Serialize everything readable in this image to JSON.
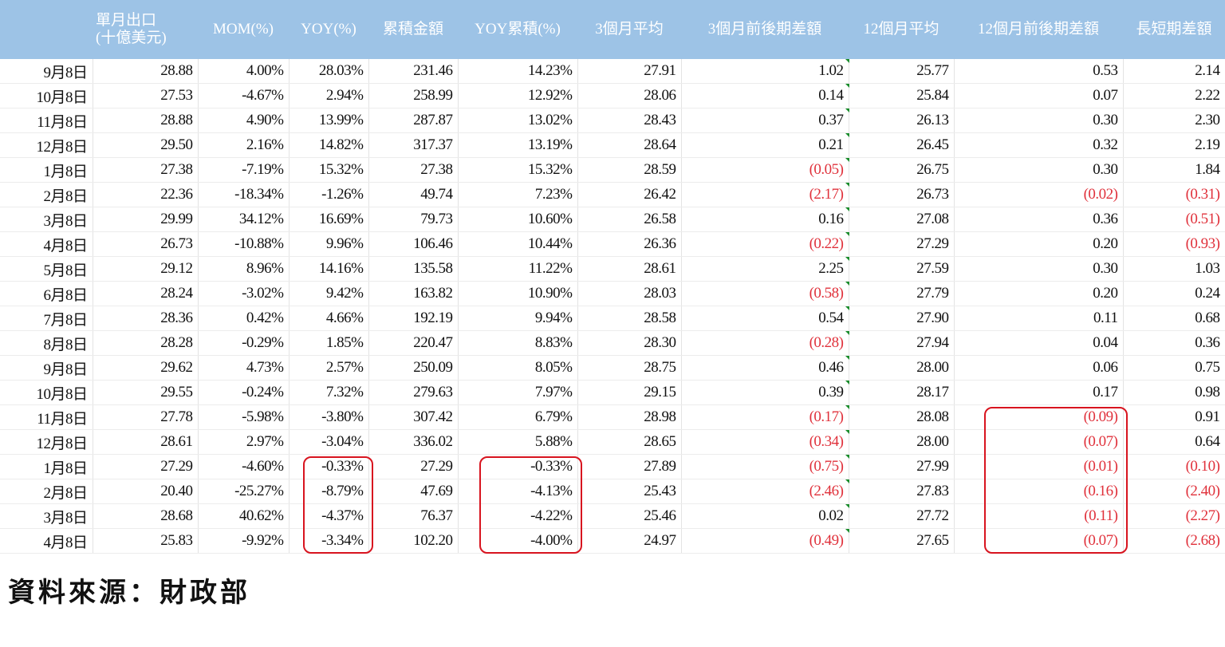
{
  "chart_data": {
    "type": "table",
    "columns": [
      "",
      "單月出口\n(十億美元)",
      "MOM(%)",
      "YOY(%)",
      "累積金額",
      "YOY累積(%)",
      "3個月平均",
      "3個月前後期差額",
      "12個月平均",
      "12個月前後期差額",
      "長短期差額"
    ],
    "rows": [
      [
        "9月8日",
        "28.88",
        "4.00%",
        "28.03%",
        "231.46",
        "14.23%",
        "27.91",
        "1.02",
        "25.77",
        "0.53",
        "2.14"
      ],
      [
        "10月8日",
        "27.53",
        "-4.67%",
        "2.94%",
        "258.99",
        "12.92%",
        "28.06",
        "0.14",
        "25.84",
        "0.07",
        "2.22"
      ],
      [
        "11月8日",
        "28.88",
        "4.90%",
        "13.99%",
        "287.87",
        "13.02%",
        "28.43",
        "0.37",
        "26.13",
        "0.30",
        "2.30"
      ],
      [
        "12月8日",
        "29.50",
        "2.16%",
        "14.82%",
        "317.37",
        "13.19%",
        "28.64",
        "0.21",
        "26.45",
        "0.32",
        "2.19"
      ],
      [
        "1月8日",
        "27.38",
        "-7.19%",
        "15.32%",
        "27.38",
        "15.32%",
        "28.59",
        "(0.05)",
        "26.75",
        "0.30",
        "1.84"
      ],
      [
        "2月8日",
        "22.36",
        "-18.34%",
        "-1.26%",
        "49.74",
        "7.23%",
        "26.42",
        "(2.17)",
        "26.73",
        "(0.02)",
        "(0.31)"
      ],
      [
        "3月8日",
        "29.99",
        "34.12%",
        "16.69%",
        "79.73",
        "10.60%",
        "26.58",
        "0.16",
        "27.08",
        "0.36",
        "(0.51)"
      ],
      [
        "4月8日",
        "26.73",
        "-10.88%",
        "9.96%",
        "106.46",
        "10.44%",
        "26.36",
        "(0.22)",
        "27.29",
        "0.20",
        "(0.93)"
      ],
      [
        "5月8日",
        "29.12",
        "8.96%",
        "14.16%",
        "135.58",
        "11.22%",
        "28.61",
        "2.25",
        "27.59",
        "0.30",
        "1.03"
      ],
      [
        "6月8日",
        "28.24",
        "-3.02%",
        "9.42%",
        "163.82",
        "10.90%",
        "28.03",
        "(0.58)",
        "27.79",
        "0.20",
        "0.24"
      ],
      [
        "7月8日",
        "28.36",
        "0.42%",
        "4.66%",
        "192.19",
        "9.94%",
        "28.58",
        "0.54",
        "27.90",
        "0.11",
        "0.68"
      ],
      [
        "8月8日",
        "28.28",
        "-0.29%",
        "1.85%",
        "220.47",
        "8.83%",
        "28.30",
        "(0.28)",
        "27.94",
        "0.04",
        "0.36"
      ],
      [
        "9月8日",
        "29.62",
        "4.73%",
        "2.57%",
        "250.09",
        "8.05%",
        "28.75",
        "0.46",
        "28.00",
        "0.06",
        "0.75"
      ],
      [
        "10月8日",
        "29.55",
        "-0.24%",
        "7.32%",
        "279.63",
        "7.97%",
        "29.15",
        "0.39",
        "28.17",
        "0.17",
        "0.98"
      ],
      [
        "11月8日",
        "27.78",
        "-5.98%",
        "-3.80%",
        "307.42",
        "6.79%",
        "28.98",
        "(0.17)",
        "28.08",
        "(0.09)",
        "0.91"
      ],
      [
        "12月8日",
        "28.61",
        "2.97%",
        "-3.04%",
        "336.02",
        "5.88%",
        "28.65",
        "(0.34)",
        "28.00",
        "(0.07)",
        "0.64"
      ],
      [
        "1月8日",
        "27.29",
        "-4.60%",
        "-0.33%",
        "27.29",
        "-0.33%",
        "27.89",
        "(0.75)",
        "27.99",
        "(0.01)",
        "(0.10)"
      ],
      [
        "2月8日",
        "20.40",
        "-25.27%",
        "-8.79%",
        "47.69",
        "-4.13%",
        "25.43",
        "(2.46)",
        "27.83",
        "(0.16)",
        "(2.40)"
      ],
      [
        "3月8日",
        "28.68",
        "40.62%",
        "-4.37%",
        "76.37",
        "-4.22%",
        "25.46",
        "0.02",
        "27.72",
        "(0.11)",
        "(2.27)"
      ],
      [
        "4月8日",
        "25.83",
        "-9.92%",
        "-3.34%",
        "102.20",
        "-4.00%",
        "24.97",
        "(0.49)",
        "27.65",
        "(0.07)",
        "(2.68)"
      ]
    ],
    "highlights": [
      {
        "column": 3,
        "row_start": 16,
        "row_end": 19
      },
      {
        "column": 5,
        "row_start": 16,
        "row_end": 19
      },
      {
        "column": 9,
        "row_start": 14,
        "row_end": 19
      }
    ]
  },
  "source_text": "資料來源：財政部",
  "colors": {
    "header_bg": "#9dc3e6",
    "negative": "#e0313b",
    "highlight": "#d8141f"
  }
}
